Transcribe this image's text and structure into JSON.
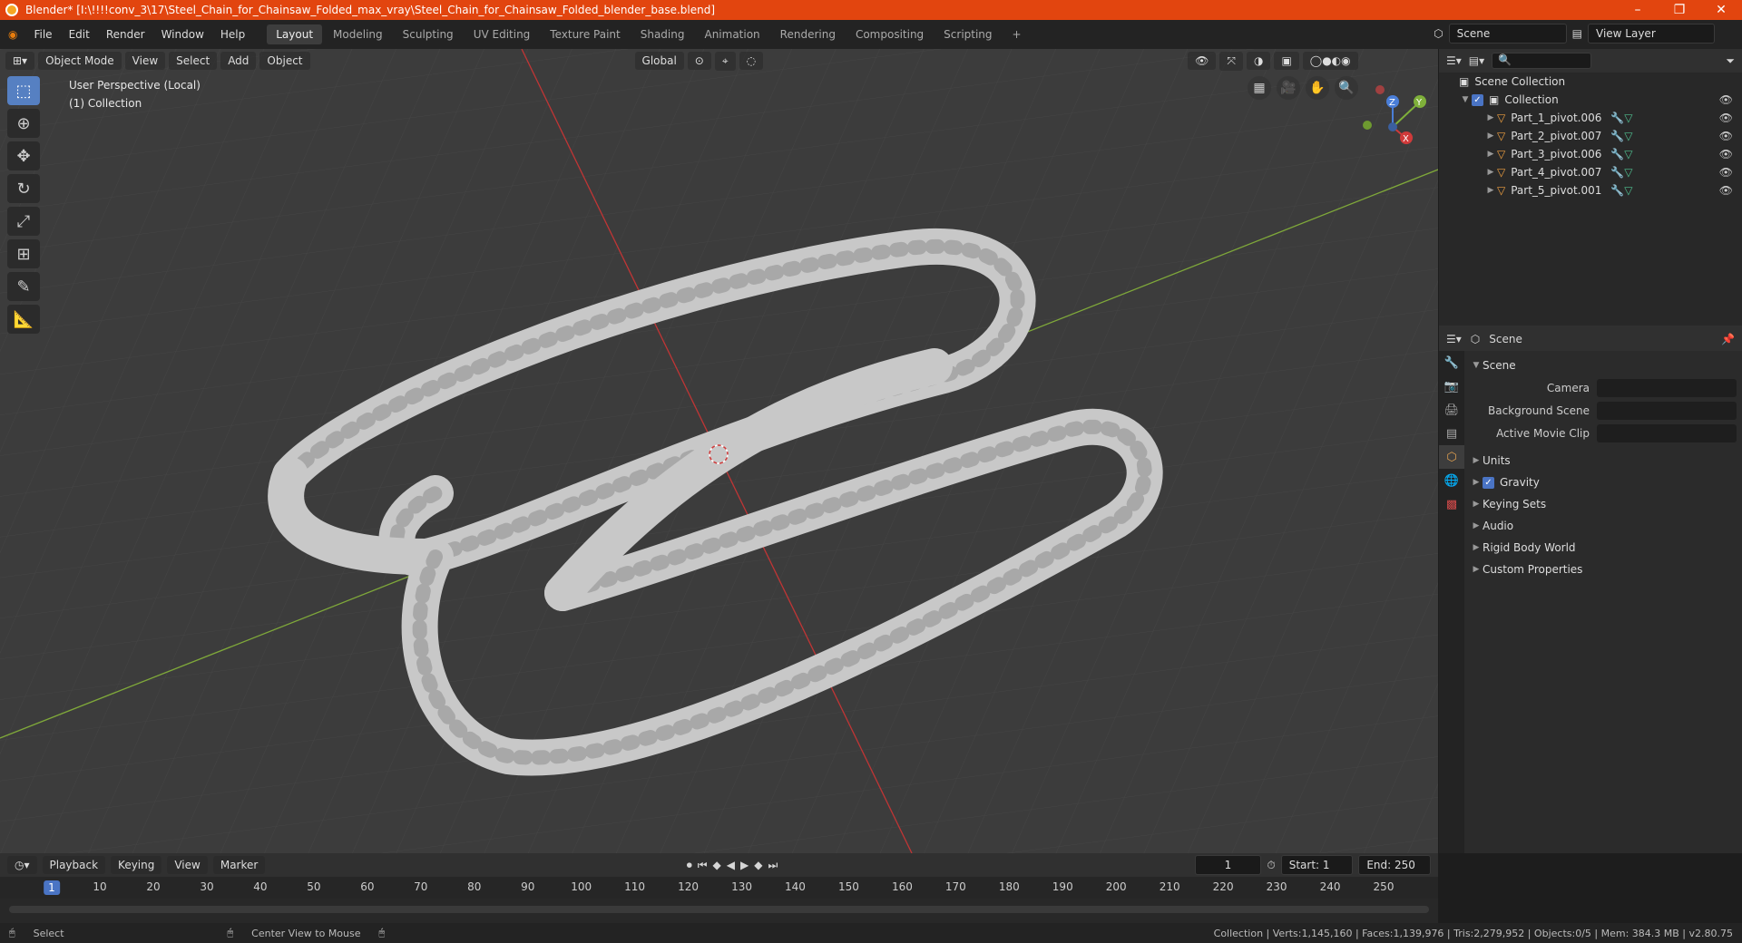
{
  "titlebar": {
    "title": "Blender* [I:\\!!!!conv_3\\17\\Steel_Chain_for_Chainsaw_Folded_max_vray\\Steel_Chain_for_Chainsaw_Folded_blender_base.blend]",
    "minimize": "–",
    "maximize": "❐",
    "close": "✕"
  },
  "menu": [
    "File",
    "Edit",
    "Render",
    "Window",
    "Help"
  ],
  "workspaces": [
    "Layout",
    "Modeling",
    "Sculpting",
    "UV Editing",
    "Texture Paint",
    "Shading",
    "Animation",
    "Rendering",
    "Compositing",
    "Scripting"
  ],
  "active_workspace": "Layout",
  "scene_field": "Scene",
  "view_layer_field": "View Layer",
  "viewport": {
    "mode": "Object Mode",
    "menus": [
      "View",
      "Select",
      "Add",
      "Object"
    ],
    "transform": "Global",
    "overlay_line1": "User Perspective (Local)",
    "overlay_line2": "(1) Collection",
    "accent_colors": {
      "x_axis": "#d03a3a",
      "y_axis": "#7fb03a",
      "selected": "#5680c2"
    }
  },
  "outliner": {
    "root": "Scene Collection",
    "collection": "Collection",
    "items": [
      "Part_1_pivot.006",
      "Part_2_pivot.007",
      "Part_3_pivot.006",
      "Part_4_pivot.007",
      "Part_5_pivot.001"
    ]
  },
  "properties": {
    "header": "Scene",
    "section": "Scene",
    "fields": [
      {
        "label": "Camera",
        "value": ""
      },
      {
        "label": "Background Scene",
        "value": ""
      },
      {
        "label": "Active Movie Clip",
        "value": ""
      }
    ],
    "subsections": [
      "Units",
      "Gravity",
      "Keying Sets",
      "Audio",
      "Rigid Body World",
      "Custom Properties"
    ]
  },
  "timeline": {
    "menus": [
      "Playback",
      "Keying",
      "View",
      "Marker"
    ],
    "current_frame": "1",
    "start_label": "Start:",
    "start": "1",
    "end_label": "End:",
    "end": "250",
    "ticks": [
      "1",
      "10",
      "20",
      "30",
      "40",
      "50",
      "60",
      "70",
      "80",
      "90",
      "100",
      "110",
      "120",
      "130",
      "140",
      "150",
      "160",
      "170",
      "180",
      "190",
      "200",
      "210",
      "220",
      "230",
      "240",
      "250"
    ]
  },
  "statusbar": {
    "left": "Select",
    "middle": "Center View to Mouse",
    "right": "Collection | Verts:1,145,160 | Faces:1,139,976 | Tris:2,279,952 | Objects:0/5 | Mem: 384.3 MB | v2.80.75"
  }
}
